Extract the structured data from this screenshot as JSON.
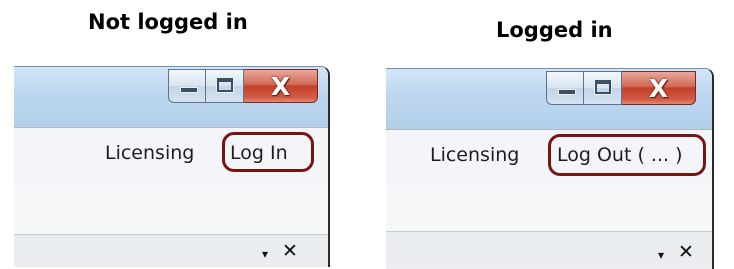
{
  "captions": {
    "left": "Not logged in",
    "right": "Logged in"
  },
  "panels": {
    "not_logged_in": {
      "window_buttons": {
        "minimize": "minimize-icon",
        "maximize": "maximize-icon",
        "close": "close-icon",
        "close_glyph": "X"
      },
      "menu": {
        "licensing": "Licensing",
        "login": "Log In"
      },
      "toolstrip": {
        "dropdown_glyph": "▾",
        "close_glyph": "✕"
      }
    },
    "logged_in": {
      "window_buttons": {
        "minimize": "minimize-icon",
        "maximize": "maximize-icon",
        "close": "close-icon",
        "close_glyph": "X"
      },
      "menu": {
        "licensing": "Licensing",
        "logout": "Log Out ( ... )"
      },
      "toolstrip": {
        "dropdown_glyph": "▾",
        "close_glyph": "✕"
      }
    }
  },
  "colors": {
    "highlight": "#7a1414",
    "titlebar": "#bcd6ee",
    "close_button": "#c2402a"
  }
}
